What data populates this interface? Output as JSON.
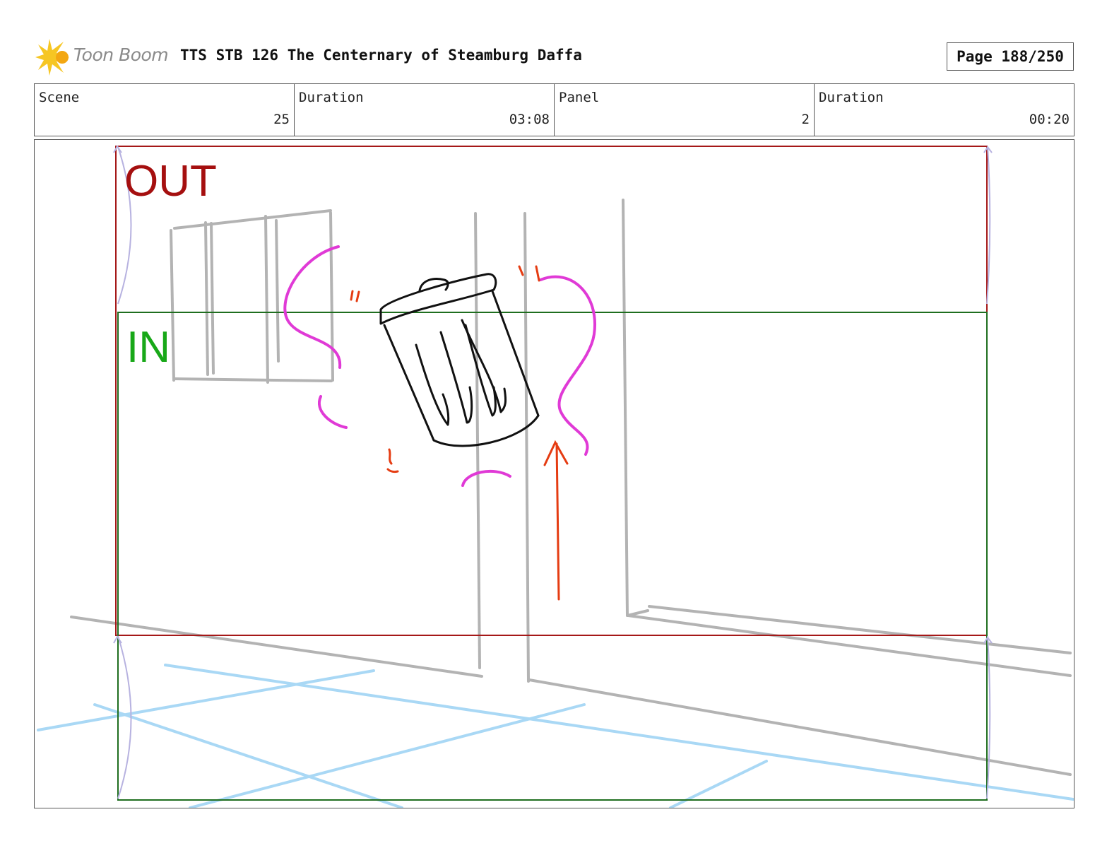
{
  "header": {
    "logo_text": "Toon Boom",
    "title": "TTS STB 126 The Centernary of Steamburg Daffa",
    "page": "Page 188/250"
  },
  "info": {
    "scene_label": "Scene",
    "scene_value": "25",
    "duration_label": "Duration",
    "duration_value": "03:08",
    "panel_label": "Panel",
    "panel_value": "2",
    "panel_duration_label": "Duration",
    "panel_duration_value": "00:20"
  },
  "camera": {
    "out_label": "OUT",
    "in_label": "IN",
    "out_color": "#a50f0f",
    "in_color": "#18a818"
  }
}
